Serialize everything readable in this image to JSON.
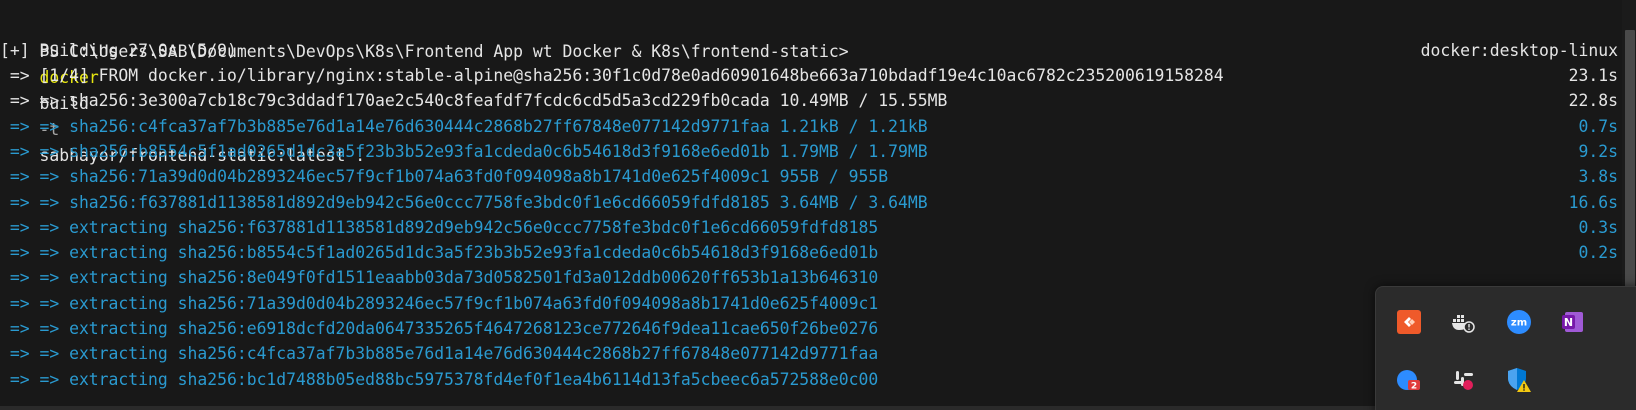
{
  "terminal": {
    "prompt_path": "PS C:\\Users\\SAB\\Documents\\DevOps\\K8s\\Frontend App wt Docker & K8s\\frontend-static>",
    "command_name": "docker",
    "command_mid": "build",
    "command_flag": "-t",
    "command_args": "sabhayor/frontend-static:latest .",
    "building": "[+] Building 27.0s (5/9)",
    "context": "docker:desktop-linux",
    "lines": [
      {
        "text": " => [1/4] FROM docker.io/library/nginx:stable-alpine@sha256:30f1c0d78e0ad60901648be663a710bdadf19e4c10ac6782c235200619158284",
        "time": "23.1s",
        "color": "white"
      },
      {
        "text": " => => sha256:3e300a7cb18c79c3ddadf170ae2c540c8feafdf7fcdc6cd5d5a3cd229fb0cada 10.49MB / 15.55MB",
        "time": "22.8s",
        "color": "white"
      },
      {
        "text": " => => sha256:c4fca37af7b3b885e76d1a14e76d630444c2868b27ff67848e077142d9771faa 1.21kB / 1.21kB",
        "time": "0.7s",
        "color": "blue"
      },
      {
        "text": " => => sha256:b8554c5f1ad0265d1dc3a5f23b3b52e93fa1cdeda0c6b54618d3f9168e6ed01b 1.79MB / 1.79MB",
        "time": "9.2s",
        "color": "blue"
      },
      {
        "text": " => => sha256:71a39d0d04b2893246ec57f9cf1b074a63fd0f094098a8b1741d0e625f4009c1 955B / 955B",
        "time": "3.8s",
        "color": "blue"
      },
      {
        "text": " => => sha256:f637881d1138581d892d9eb942c56e0ccc7758fe3bdc0f1e6cd66059fdfd8185 3.64MB / 3.64MB",
        "time": "16.6s",
        "color": "blue"
      },
      {
        "text": " => => extracting sha256:f637881d1138581d892d9eb942c56e0ccc7758fe3bdc0f1e6cd66059fdfd8185",
        "time": "0.3s",
        "color": "blue"
      },
      {
        "text": " => => extracting sha256:b8554c5f1ad0265d1dc3a5f23b3b52e93fa1cdeda0c6b54618d3f9168e6ed01b",
        "time": "0.2s",
        "color": "blue"
      },
      {
        "text": " => => extracting sha256:8e049f0fd1511eaabb03da73d0582501fd3a012ddb00620ff653b1a13b646310",
        "time": "",
        "color": "blue"
      },
      {
        "text": " => => extracting sha256:71a39d0d04b2893246ec57f9cf1b074a63fd0f094098a8b1741d0e625f4009c1",
        "time": "",
        "color": "blue"
      },
      {
        "text": " => => extracting sha256:e6918dcfd20da0647335265f4647268123ce772646f9dea11cae650f26be0276",
        "time": "",
        "color": "blue"
      },
      {
        "text": " => => extracting sha256:c4fca37af7b3b885e76d1a14e76d630444c2868b27ff67848e077142d9771faa",
        "time": "",
        "color": "blue"
      },
      {
        "text": " => => extracting sha256:bc1d7488b05ed88bc5975378fd4ef0f1ea4b6114d13fa5cbeec6a572588e0c00",
        "time": "",
        "color": "blue"
      }
    ]
  },
  "tray": {
    "icons": [
      {
        "name": "anydesk-icon",
        "color": "#ef5a2a"
      },
      {
        "name": "docker-icon",
        "color": "#e5e5e5"
      },
      {
        "name": "zoom-icon",
        "color": "#2d8cff",
        "label": "zm"
      },
      {
        "name": "onenote-icon",
        "color": "#7719aa",
        "label": "N"
      },
      {
        "name": "mail-notification-icon",
        "color": "#2d8cff",
        "badge": "2"
      },
      {
        "name": "slack-icon",
        "color": "#e01e5a"
      },
      {
        "name": "defender-warning-icon",
        "color": "#0078d4"
      }
    ]
  },
  "colors": {
    "background": "#181818",
    "blue_text": "#2a9ad0",
    "white_text": "#e5e5e5",
    "yellow_text": "#e5e510"
  }
}
